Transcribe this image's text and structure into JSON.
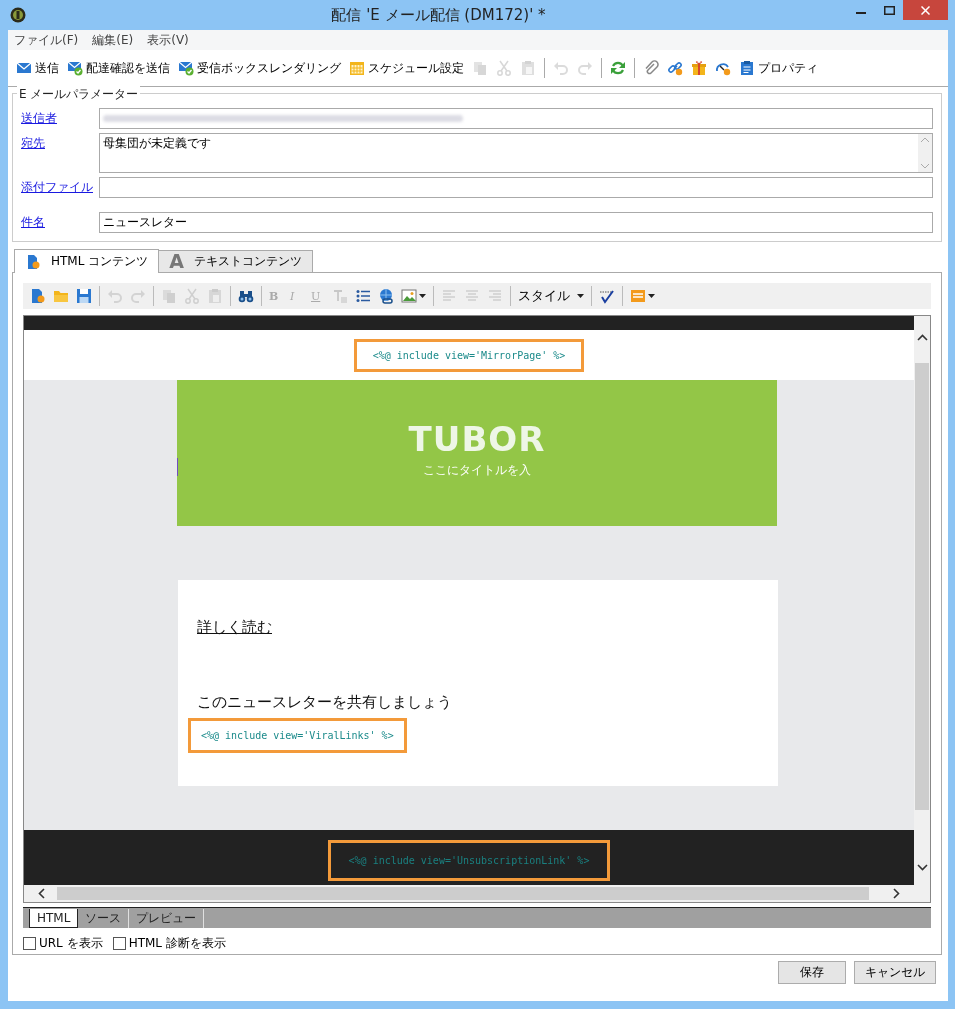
{
  "window": {
    "title": "配信 'E メール配信 (DM172)' *"
  },
  "menu": [
    "ファイル(F)",
    "編集(E)",
    "表示(V)"
  ],
  "toolbar": [
    {
      "kind": "button",
      "label": "送信",
      "disabled": false
    },
    {
      "kind": "button",
      "label": "配達確認を送信",
      "disabled": false
    },
    {
      "kind": "button",
      "label": "受信ボックスレンダリング",
      "disabled": false
    },
    {
      "kind": "button",
      "label": "スケジュール設定",
      "disabled": false
    },
    {
      "kind": "button",
      "disabled": true
    },
    {
      "kind": "button",
      "disabled": true
    },
    {
      "kind": "button",
      "disabled": true
    },
    {
      "kind": "separator"
    },
    {
      "kind": "button",
      "disabled": true
    },
    {
      "kind": "button",
      "disabled": true
    },
    {
      "kind": "separator"
    },
    {
      "kind": "button",
      "disabled": false
    },
    {
      "kind": "separator"
    },
    {
      "kind": "button",
      "disabled": false
    },
    {
      "kind": "button",
      "disabled": false
    },
    {
      "kind": "button",
      "disabled": false
    },
    {
      "kind": "button",
      "disabled": false
    },
    {
      "kind": "button",
      "label": "プロパティ",
      "disabled": false
    }
  ],
  "parameters": {
    "legend": "E メールパラメーター",
    "fields": [
      {
        "kind": "line",
        "label": "送信者"
      },
      {
        "kind": "textarea",
        "label": "宛先",
        "value": "母集団が未定義です"
      },
      {
        "kind": "line",
        "label": "添付ファイル"
      },
      {
        "kind": "line",
        "label": "件名",
        "value": "ニュースレター"
      }
    ]
  },
  "content_tabs": [
    {
      "label": "HTML コンテンツ",
      "selected": true
    },
    {
      "label": "テキストコンテンツ",
      "glyph": "A",
      "selected": false
    }
  ],
  "editor_toolbar": [
    {
      "kind": "icon",
      "disabled": false
    },
    {
      "kind": "icon",
      "disabled": false
    },
    {
      "kind": "icon",
      "disabled": false
    },
    {
      "kind": "separator"
    },
    {
      "kind": "icon",
      "disabled": true
    },
    {
      "kind": "icon",
      "disabled": true
    },
    {
      "kind": "separator"
    },
    {
      "kind": "icon",
      "disabled": true
    },
    {
      "kind": "icon",
      "disabled": true
    },
    {
      "kind": "icon",
      "disabled": true
    },
    {
      "kind": "separator"
    },
    {
      "kind": "icon",
      "disabled": false
    },
    {
      "kind": "separator"
    },
    {
      "kind": "letter",
      "label": "B",
      "disabled": true
    },
    {
      "kind": "letter",
      "label": "I",
      "disabled": true
    },
    {
      "kind": "letter",
      "label": "U",
      "disabled": true
    },
    {
      "kind": "icon",
      "disabled": true
    },
    {
      "kind": "icon",
      "disabled": false
    },
    {
      "kind": "icon",
      "disabled": false
    },
    {
      "kind": "icon",
      "disabled": false,
      "dropdown": true
    },
    {
      "kind": "separator"
    },
    {
      "kind": "icon",
      "disabled": true
    },
    {
      "kind": "icon",
      "disabled": true
    },
    {
      "kind": "icon",
      "disabled": true
    },
    {
      "kind": "separator"
    },
    {
      "kind": "dropdown",
      "label": "スタイル"
    },
    {
      "kind": "separator"
    },
    {
      "kind": "icon",
      "disabled": false
    },
    {
      "kind": "separator"
    },
    {
      "kind": "icon",
      "disabled": false,
      "dropdown": true
    }
  ],
  "email": {
    "mirror_code": "<%@ include view='MirrorPage' %>",
    "logo": "TUBOR",
    "banner_title": "ここにタイトルを入",
    "read_more": "詳しく読む",
    "share_text": "このニュースレターを共有しましょう",
    "viral_code": "<%@ include view='ViralLinks' %>",
    "unsubscribe_code": "<%@ include view='UnsubscriptionLink' %>"
  },
  "view_tabs": [
    {
      "label": "HTML",
      "selected": true
    },
    {
      "label": "ソース",
      "selected": false
    },
    {
      "label": "プレビュー",
      "selected": false
    }
  ],
  "options": [
    {
      "label": "URL を表示",
      "checked": false
    },
    {
      "label": "HTML 診断を表示",
      "checked": false
    }
  ],
  "buttons": [
    "保存",
    "キャンセル"
  ]
}
